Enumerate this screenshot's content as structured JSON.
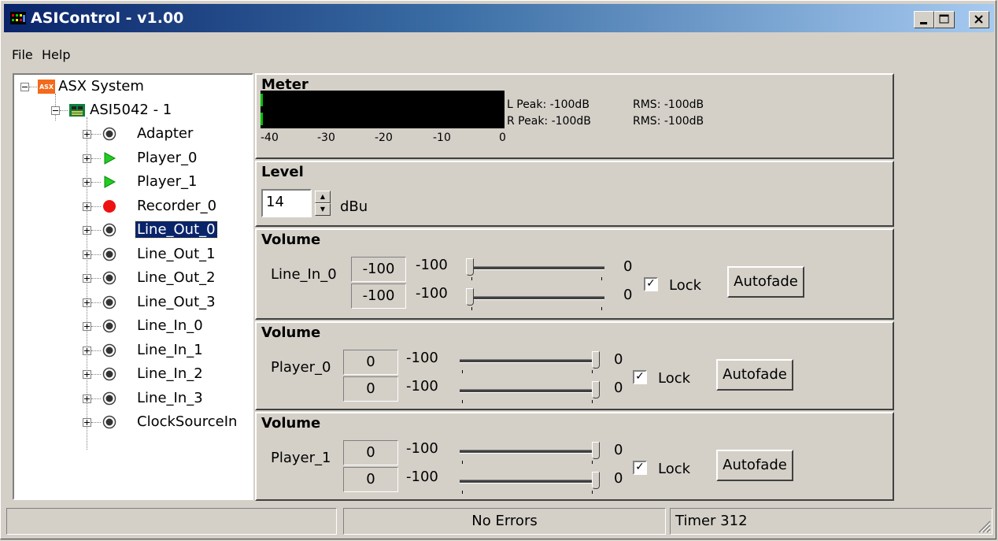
{
  "window": {
    "title": "ASIControl - v1.00"
  },
  "menu": [
    {
      "label": "File"
    },
    {
      "label": "Help"
    }
  ],
  "tree": {
    "root": {
      "label": "ASX System",
      "icon": "asx-logo-icon"
    },
    "device": {
      "label": "ASI5042 - 1",
      "icon": "circuit-board-icon"
    },
    "nodes": [
      {
        "label": "Adapter",
        "icon": "node-dot-icon"
      },
      {
        "label": "Player_0",
        "icon": "play-icon"
      },
      {
        "label": "Player_1",
        "icon": "play-icon"
      },
      {
        "label": "Recorder_0",
        "icon": "record-icon"
      },
      {
        "label": "Line_Out_0",
        "icon": "node-dot-icon",
        "selected": true
      },
      {
        "label": "Line_Out_1",
        "icon": "node-dot-icon"
      },
      {
        "label": "Line_Out_2",
        "icon": "node-dot-icon"
      },
      {
        "label": "Line_Out_3",
        "icon": "node-dot-icon"
      },
      {
        "label": "Line_In_0",
        "icon": "node-dot-icon"
      },
      {
        "label": "Line_In_1",
        "icon": "node-dot-icon"
      },
      {
        "label": "Line_In_2",
        "icon": "node-dot-icon"
      },
      {
        "label": "Line_In_3",
        "icon": "node-dot-icon"
      },
      {
        "label": "ClockSourceIn",
        "icon": "node-dot-icon"
      }
    ]
  },
  "meter": {
    "title": "Meter",
    "scale": [
      "-40",
      "-30",
      "-20",
      "-10",
      "0"
    ],
    "l_peak": "L Peak: -100dB",
    "r_peak": "R Peak: -100dB",
    "l_rms": "RMS: -100dB",
    "r_rms": "RMS: -100dB"
  },
  "level": {
    "title": "Level",
    "value": "14",
    "unit": "dBu"
  },
  "volumes": [
    {
      "title": "Volume",
      "name": "Line_In_0",
      "ch1_value": "-100",
      "ch2_value": "-100",
      "min_label": "-100",
      "max_label": "0",
      "ch1_level": 0.0,
      "ch2_level": 0.0,
      "lock_label": "Lock",
      "lock_checked": true,
      "autofade_label": "Autofade"
    },
    {
      "title": "Volume",
      "name": "Player_0",
      "ch1_value": "0",
      "ch2_value": "0",
      "min_label": "-100",
      "max_label": "0",
      "ch1_level": 1.0,
      "ch2_level": 1.0,
      "lock_label": "Lock",
      "lock_checked": true,
      "autofade_label": "Autofade"
    },
    {
      "title": "Volume",
      "name": "Player_1",
      "ch1_value": "0",
      "ch2_value": "0",
      "min_label": "-100",
      "max_label": "0",
      "ch1_level": 1.0,
      "ch2_level": 1.0,
      "lock_label": "Lock",
      "lock_checked": true,
      "autofade_label": "Autofade"
    }
  ],
  "status": {
    "left": "",
    "center": "No Errors",
    "right": "Timer 312"
  }
}
